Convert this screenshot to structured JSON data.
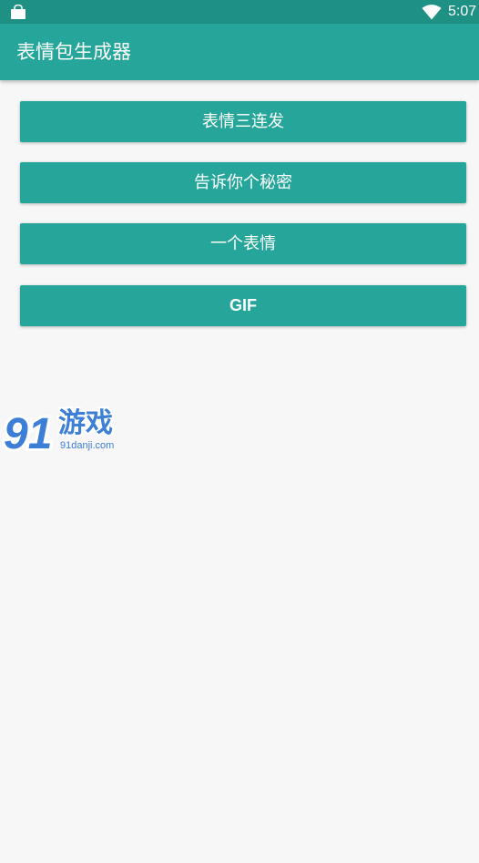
{
  "status_bar": {
    "time": "5:07",
    "icons": [
      "shopping-bag-icon",
      "wifi-icon"
    ]
  },
  "app_bar": {
    "title": "表情包生成器"
  },
  "buttons": [
    {
      "label": "表情三连发"
    },
    {
      "label": "告诉你个秘密"
    },
    {
      "label": "一个表情"
    },
    {
      "label": "GIF"
    }
  ],
  "watermark": {
    "logo_text": "91",
    "name": "游戏",
    "url": "91danji.com"
  },
  "colors": {
    "primary": "#26a69a",
    "primary_dark": "#1f9184",
    "background": "#f7f7f7",
    "watermark_blue": "#3d7fd6"
  }
}
